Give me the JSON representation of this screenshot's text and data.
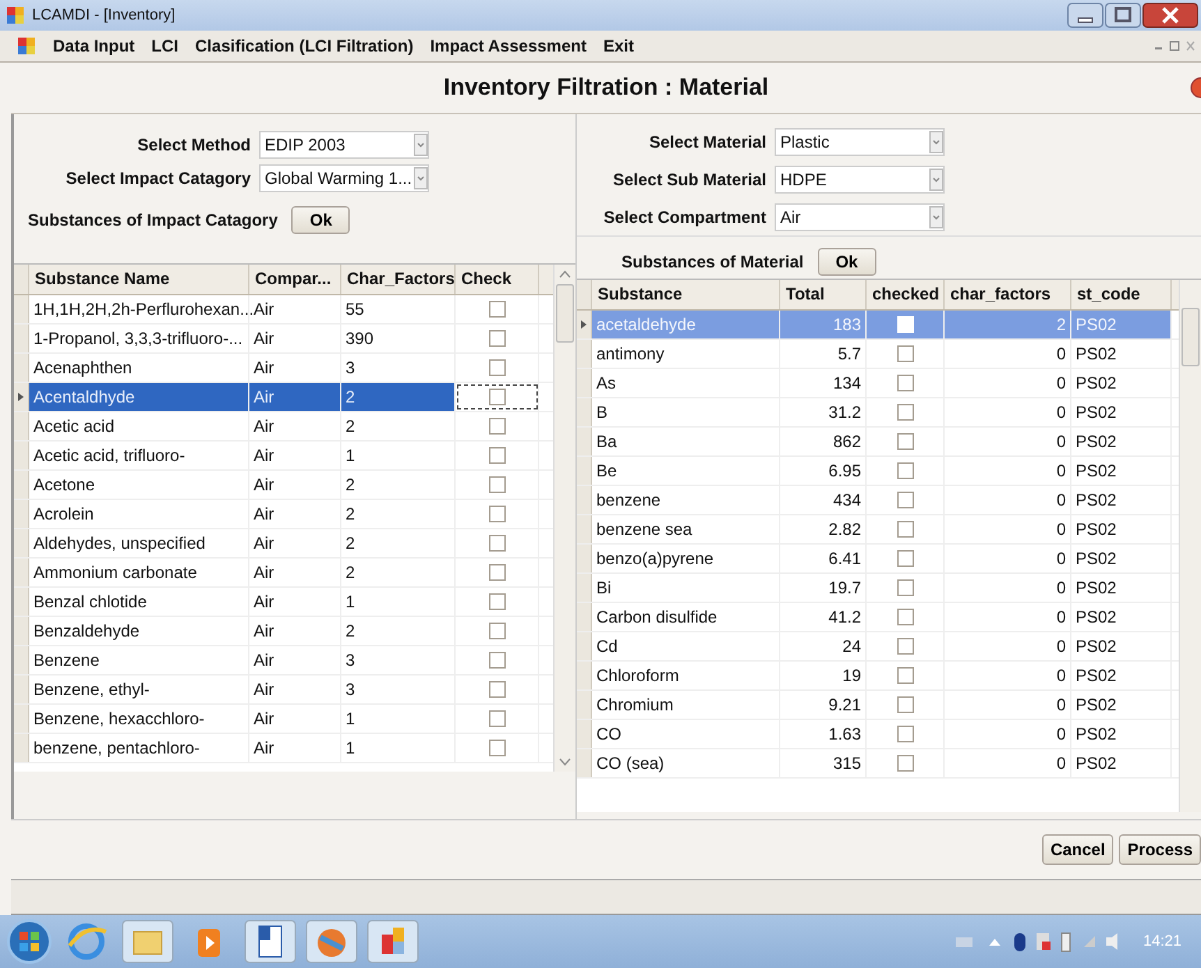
{
  "window": {
    "title": "LCAMDI - [Inventory]"
  },
  "menu": [
    "Data Input",
    "LCI",
    "Clasification (LCI Filtration)",
    "Impact Assessment",
    "Exit"
  ],
  "heading": "Inventory Filtration : Material",
  "left_form": {
    "fields": [
      {
        "label": "Select Method",
        "value": "EDIP 2003"
      },
      {
        "label": "Select Impact Catagory",
        "value": "Global Warming 1..."
      }
    ],
    "caption": "Substances of Impact Catagory",
    "button": "Ok"
  },
  "left_table": {
    "columns": [
      "Substance Name",
      "Compar...",
      "Char_Factors",
      "Check"
    ],
    "rows": [
      {
        "name": "1H,1H,2H,2h-Perflurohexan...",
        "compartment": "Air",
        "factor": "55",
        "checked": false,
        "selected": false
      },
      {
        "name": "1-Propanol, 3,3,3-trifluoro-...",
        "compartment": "Air",
        "factor": "390",
        "checked": false,
        "selected": false
      },
      {
        "name": "Acenaphthen",
        "compartment": "Air",
        "factor": "3",
        "checked": false,
        "selected": false
      },
      {
        "name": "Acentaldhyde",
        "compartment": "Air",
        "factor": "2",
        "checked": false,
        "selected": true
      },
      {
        "name": "Acetic acid",
        "compartment": "Air",
        "factor": "2",
        "checked": false,
        "selected": false
      },
      {
        "name": "Acetic acid, trifluoro-",
        "compartment": "Air",
        "factor": "1",
        "checked": false,
        "selected": false
      },
      {
        "name": "Acetone",
        "compartment": "Air",
        "factor": "2",
        "checked": false,
        "selected": false
      },
      {
        "name": "Acrolein",
        "compartment": "Air",
        "factor": "2",
        "checked": false,
        "selected": false
      },
      {
        "name": "Aldehydes, unspecified",
        "compartment": "Air",
        "factor": "2",
        "checked": false,
        "selected": false
      },
      {
        "name": "Ammonium carbonate",
        "compartment": "Air",
        "factor": "2",
        "checked": false,
        "selected": false
      },
      {
        "name": "Benzal chlotide",
        "compartment": "Air",
        "factor": "1",
        "checked": false,
        "selected": false
      },
      {
        "name": "Benzaldehyde",
        "compartment": "Air",
        "factor": "2",
        "checked": false,
        "selected": false
      },
      {
        "name": "Benzene",
        "compartment": "Air",
        "factor": "3",
        "checked": false,
        "selected": false
      },
      {
        "name": "Benzene, ethyl-",
        "compartment": "Air",
        "factor": "3",
        "checked": false,
        "selected": false
      },
      {
        "name": "Benzene, hexacchloro-",
        "compartment": "Air",
        "factor": "1",
        "checked": false,
        "selected": false
      },
      {
        "name": "benzene, pentachloro-",
        "compartment": "Air",
        "factor": "1",
        "checked": false,
        "selected": false
      }
    ]
  },
  "right_form": {
    "fields": [
      {
        "label": "Select Material",
        "value": "Plastic"
      },
      {
        "label": "Select Sub Material",
        "value": "HDPE"
      },
      {
        "label": "Select Compartment",
        "value": "Air"
      }
    ],
    "caption": "Substances of Material",
    "button": "Ok"
  },
  "right_table": {
    "columns": [
      "Substance",
      "Total",
      "checked",
      "char_factors",
      "st_code"
    ],
    "rows": [
      {
        "substance": "acetaldehyde",
        "total": "183",
        "checked": false,
        "char_factors": "2",
        "st_code": "PS02",
        "selected": true
      },
      {
        "substance": "antimony",
        "total": "5.7",
        "checked": false,
        "char_factors": "0",
        "st_code": "PS02",
        "selected": false
      },
      {
        "substance": "As",
        "total": "134",
        "checked": false,
        "char_factors": "0",
        "st_code": "PS02",
        "selected": false
      },
      {
        "substance": "B",
        "total": "31.2",
        "checked": false,
        "char_factors": "0",
        "st_code": "PS02",
        "selected": false
      },
      {
        "substance": "Ba",
        "total": "862",
        "checked": false,
        "char_factors": "0",
        "st_code": "PS02",
        "selected": false
      },
      {
        "substance": "Be",
        "total": "6.95",
        "checked": false,
        "char_factors": "0",
        "st_code": "PS02",
        "selected": false
      },
      {
        "substance": "benzene",
        "total": "434",
        "checked": false,
        "char_factors": "0",
        "st_code": "PS02",
        "selected": false
      },
      {
        "substance": "benzene sea",
        "total": "2.82",
        "checked": false,
        "char_factors": "0",
        "st_code": "PS02",
        "selected": false
      },
      {
        "substance": "benzo(a)pyrene",
        "total": "6.41",
        "checked": false,
        "char_factors": "0",
        "st_code": "PS02",
        "selected": false
      },
      {
        "substance": "Bi",
        "total": "19.7",
        "checked": false,
        "char_factors": "0",
        "st_code": "PS02",
        "selected": false
      },
      {
        "substance": "Carbon disulfide",
        "total": "41.2",
        "checked": false,
        "char_factors": "0",
        "st_code": "PS02",
        "selected": false
      },
      {
        "substance": "Cd",
        "total": "24",
        "checked": false,
        "char_factors": "0",
        "st_code": "PS02",
        "selected": false
      },
      {
        "substance": "Chloroform",
        "total": "19",
        "checked": false,
        "char_factors": "0",
        "st_code": "PS02",
        "selected": false
      },
      {
        "substance": "Chromium",
        "total": "9.21",
        "checked": false,
        "char_factors": "0",
        "st_code": "PS02",
        "selected": false
      },
      {
        "substance": "CO",
        "total": "1.63",
        "checked": false,
        "char_factors": "0",
        "st_code": "PS02",
        "selected": false
      },
      {
        "substance": "CO (sea)",
        "total": "315",
        "checked": false,
        "char_factors": "0",
        "st_code": "PS02",
        "selected": false
      }
    ]
  },
  "buttons": [
    "Cancel",
    "Process"
  ],
  "taskbar": {
    "clock": "14:21"
  }
}
